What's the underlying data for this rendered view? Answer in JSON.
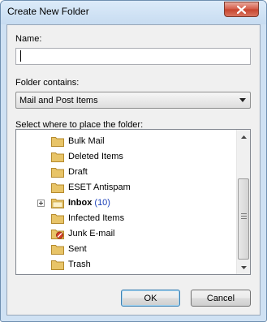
{
  "window": {
    "title": "Create New Folder",
    "close_glyph": "✕"
  },
  "name": {
    "label": "Name:",
    "value": ""
  },
  "folder_contains": {
    "label": "Folder contains:",
    "selected": "Mail and Post Items"
  },
  "tree": {
    "label": "Select where to place the folder:",
    "items": [
      {
        "label": "Bulk Mail",
        "icon": "folder-icon"
      },
      {
        "label": "Deleted Items",
        "icon": "folder-icon"
      },
      {
        "label": "Draft",
        "icon": "folder-icon"
      },
      {
        "label": "ESET Antispam",
        "icon": "folder-icon"
      },
      {
        "label": "Inbox",
        "count": "(10)",
        "icon": "folder-open-icon",
        "bold": true
      },
      {
        "label": "Infected Items",
        "icon": "folder-icon"
      },
      {
        "label": "Junk E-mail",
        "icon": "junk-folder-icon"
      },
      {
        "label": "Sent",
        "icon": "folder-icon"
      },
      {
        "label": "Trash",
        "icon": "folder-icon"
      }
    ]
  },
  "buttons": {
    "ok": "OK",
    "cancel": "Cancel"
  },
  "colors": {
    "folder": "#e8c468",
    "close": "#c7432d",
    "count": "#1a3fb8"
  }
}
